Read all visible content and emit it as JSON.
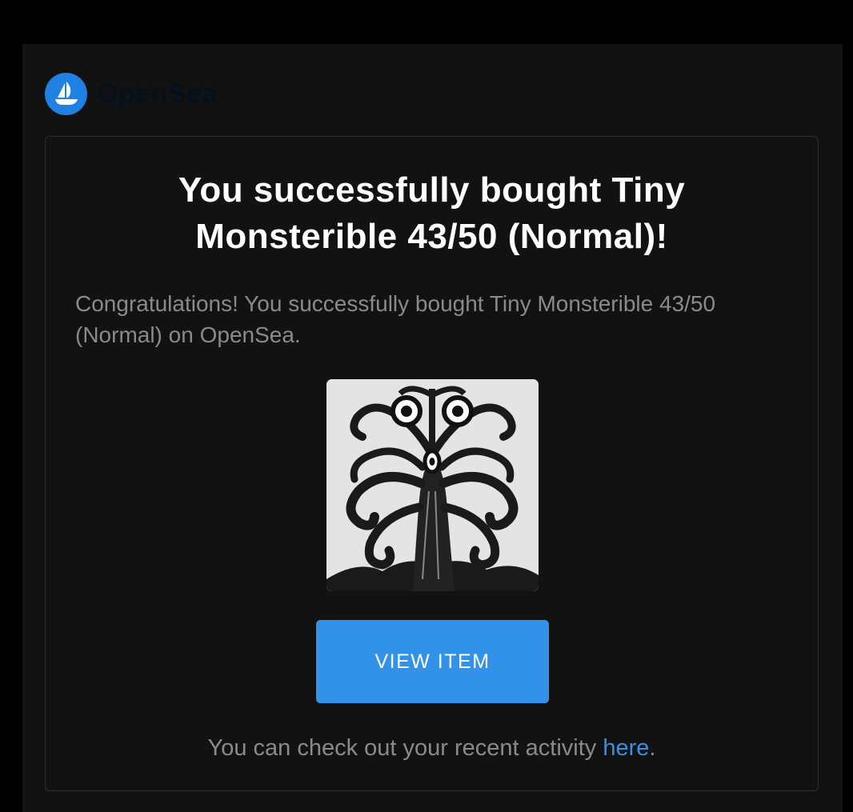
{
  "brand": {
    "name": "OpenSea",
    "logo_icon": "sailboat-icon",
    "color": "#2081e2"
  },
  "email": {
    "headline": "You successfully bought Tiny Monsterible 43/50 (Normal)!",
    "intro": "Congratulations! You successfully bought Tiny Monsterible 43/50 (Normal) on OpenSea.",
    "image_subject": "black-and-white ink illustration of a tentacled tree monster with three eyes",
    "cta_label": "VIEW ITEM",
    "activity_prefix": "You can check out your recent activity ",
    "activity_link": "here",
    "activity_suffix": "."
  },
  "colors": {
    "background": "#121212",
    "accent": "#3291e9",
    "muted_text": "#8a8a8a"
  }
}
